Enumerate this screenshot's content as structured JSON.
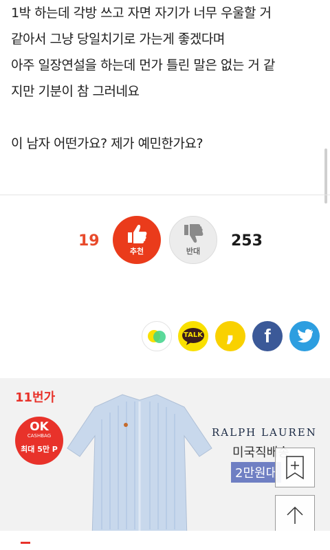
{
  "article": {
    "lines": [
      "1박 하는데 각방 쓰고 자면 자기가 너무 우울할 거",
      "같아서 그냥 당일치기로 가는게 좋겠다며",
      "아주 일장연설을 하는데 먼가 틀린 말은 없는 거 같",
      "지만 기분이 참 그러네요",
      "이 남자 어떤가요? 제가 예민한가요?"
    ]
  },
  "vote": {
    "up_count": "19",
    "up_label": "추천",
    "down_label": "반대",
    "down_count": "253",
    "up_color": "#ea3b1b"
  },
  "share": {
    "icons": [
      "kakaostory-icon",
      "kakaotalk-icon",
      "comma-icon",
      "facebook-icon",
      "twitter-icon"
    ],
    "talk_text": "TALK",
    "facebook_glyph": "f",
    "comma_glyph": ","
  },
  "ad": {
    "store_logo": "11번가",
    "ok_badge_title": "OK",
    "ok_badge_sub": "CASHBAG",
    "ok_badge_max": "최대 5만 P",
    "brand": "RALPH LAUREN",
    "subtitle": "미국직배송",
    "price": "2만원대"
  },
  "colors": {
    "accent": "#ea3b1b",
    "facebook": "#3b5998",
    "twitter": "#2d9ee0",
    "kakao": "#f9e000"
  }
}
